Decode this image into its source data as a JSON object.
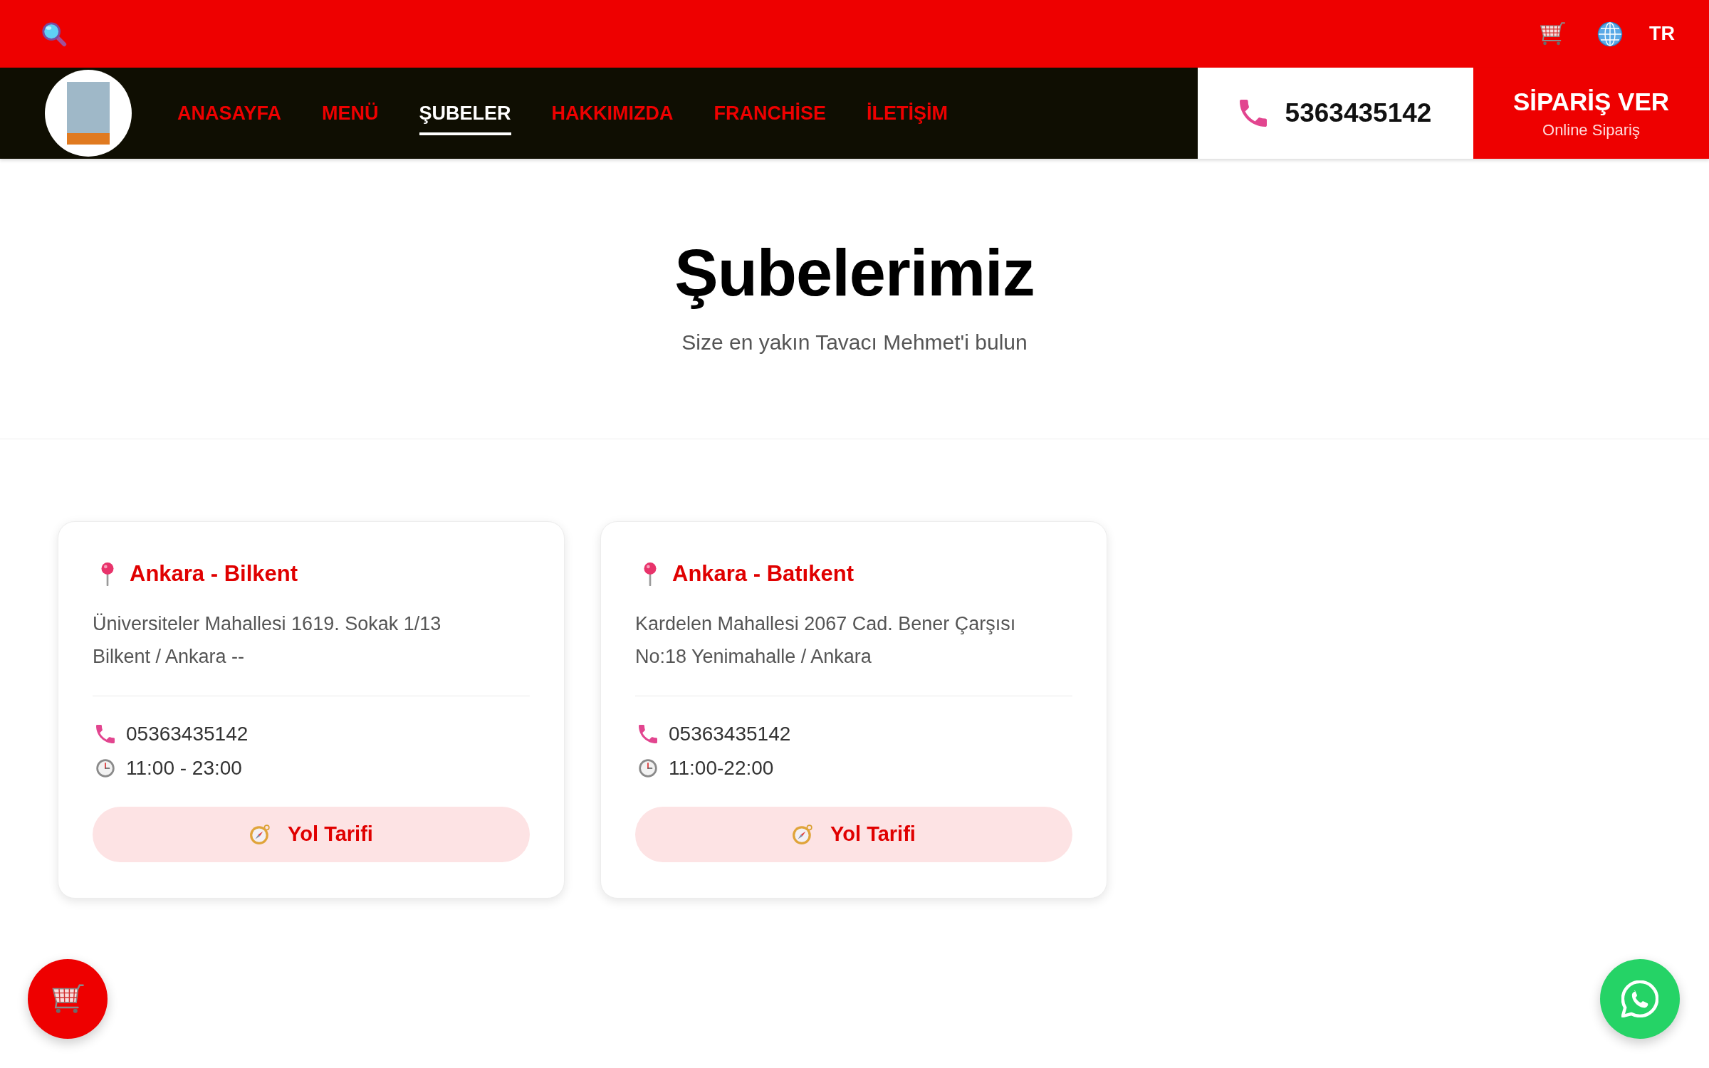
{
  "top_bar": {
    "language": "TR"
  },
  "nav": {
    "items": [
      {
        "label": "ANASAYFA",
        "selected": false
      },
      {
        "label": "MENÜ",
        "selected": false
      },
      {
        "label": "ŞUBELER",
        "selected": true
      },
      {
        "label": "HAKKIMIZDA",
        "selected": false
      },
      {
        "label": "FRANCHİSE",
        "selected": false
      },
      {
        "label": "İLETİŞİM",
        "selected": false
      }
    ],
    "phone": "5363435142",
    "order_button": {
      "label": "SİPARİŞ VER",
      "sublabel": "Online Sipariş"
    }
  },
  "hero": {
    "title": "Şubelerimiz",
    "subtitle": "Size en yakın Tavacı Mehmet'i bulun"
  },
  "branches": [
    {
      "name": "Ankara - Bilkent",
      "address_lines": [
        "Üniversiteler Mahallesi 1619. Sokak 1/13",
        "Bilkent / Ankara --"
      ],
      "phone": "05363435142",
      "hours": "11:00 - 23:00",
      "directions_button": "Yol Tarifi"
    },
    {
      "name": "Ankara - Batıkent",
      "address_lines": [
        "Kardelen Mahallesi 2067 Cad. Bener Çarşısı",
        "No:18 Yenimahalle / Ankara"
      ],
      "phone": "05363435142",
      "hours": "11:00-22:00",
      "directions_button": "Yol Tarifi"
    }
  ]
}
